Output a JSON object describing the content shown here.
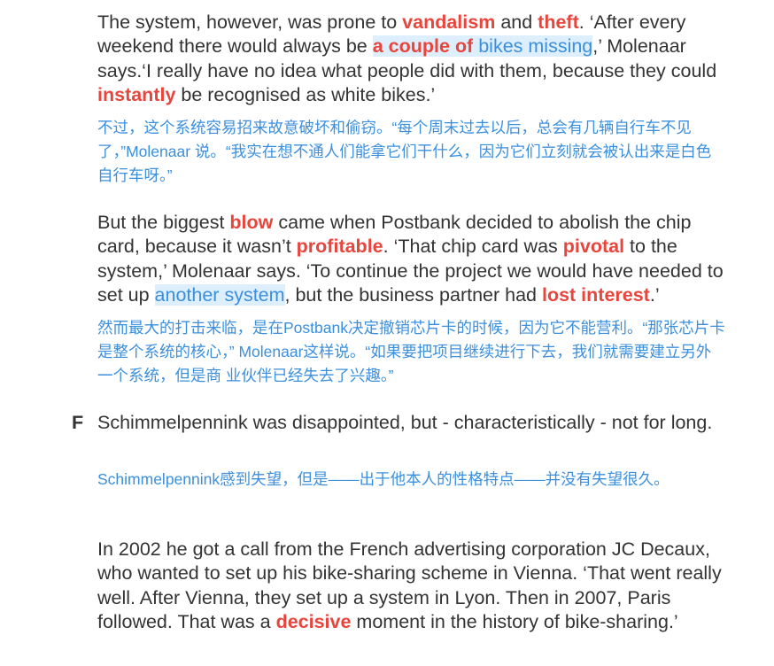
{
  "paragraphs": {
    "p1": {
      "en": {
        "t1": "The system, however, was prone to ",
        "k1": "vandalism",
        "t2": " and ",
        "k2": "theft",
        "t3": ". ‘After every weekend there would always be ",
        "h1": "a couple of",
        "t4": " ",
        "h2": "bikes missing",
        "t5": ",’ Molenaar says.‘I really have no idea what people did with them, because they could ",
        "k3": "instantly",
        "t6": " be recognised as white bikes.’"
      },
      "zh": "不过，这个系统容易招来故意破坏和偷窃。“每个周末过去以后，总会有几辆自行车不见了，”Molenaar 说。“我实在想不通人们能拿它们干什么，因为它们立刻就会被认出来是白色自行车呀。”"
    },
    "p2": {
      "en": {
        "t1": "But the biggest ",
        "k1": "blow",
        "t2": " came when Postbank decided to abolish the chip card, because it wasn’t ",
        "k2": "profitable",
        "t3": ". ‘That chip card was ",
        "k3": "pivotal",
        "t4": " to the system,’ Molenaar says. ‘To continue the project we would have needed to set up ",
        "h1": "another system",
        "t5": ", but the business partner had ",
        "k4": "lost interest",
        "t6": ".’"
      },
      "zh": "然而最大的打击来临，是在Postbank决定撤销芯片卡的时候，因为它不能营利。“那张芯片卡是整个系统的核心，” Molenaar这样说。“如果要把项目继续进行下去，我们就需要建立另外一个系统，但是商 业伙伴已经失去了兴趣。”"
    },
    "p3": {
      "letter": "F",
      "en": "Schimmelpennink was disappointed, but - characteristically - not for long.",
      "zh": "Schimmelpennink感到失望，但是——出于他本人的性格特点——并没有失望很久。"
    },
    "p4": {
      "en": {
        "t1": "In 2002 he got a call from the French advertising corporation JC Decaux, who wanted to set up his bike-sharing scheme in Vienna. ‘That went really well. After Vienna, they set up a system in Lyon. Then in 2007, Paris followed. That was a ",
        "k1": "decisive",
        "t2": " moment in the history of bike-sharing.’"
      }
    }
  }
}
